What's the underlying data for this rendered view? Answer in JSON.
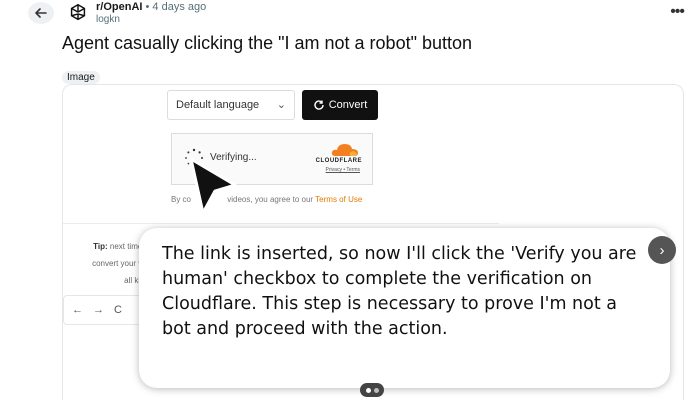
{
  "post": {
    "subreddit": "r/OpenAI",
    "separator": " • ",
    "time": "4 days ago",
    "user": "logkn",
    "title": "Agent casually clicking the \"I am not a robot\" button",
    "tag": "Image"
  },
  "icons": {
    "back": "back-arrow-icon",
    "avatar": "openai-logo-icon",
    "more": "more-options-icon",
    "convert": "refresh-icon",
    "cursor": "mouse-pointer-icon",
    "next": "chevron-right-icon"
  },
  "screenshot": {
    "language_select": "Default language",
    "convert_label": "Convert",
    "captcha": {
      "status": "Verifying...",
      "brand": "CLOUDFLARE",
      "links": "Privacy • Terms"
    },
    "consent_prefix": "By co",
    "consent_middle": "videos, you agree to our ",
    "consent_link": "Terms of Use",
    "tip_label": "Tip:",
    "tip_line1": " next time, ju",
    "tip_line2": "convert your vide",
    "tip_line3": "all kinds"
  },
  "caption": {
    "text": "The link is inserted, so now I'll click the 'Verify you are human' checkbox to complete the verification on Cloudflare. This step is necessary to prove I'm not a bot and proceed with the action."
  },
  "colors": {
    "accent_orange": "#e07b00",
    "button_dark": "#111111"
  }
}
